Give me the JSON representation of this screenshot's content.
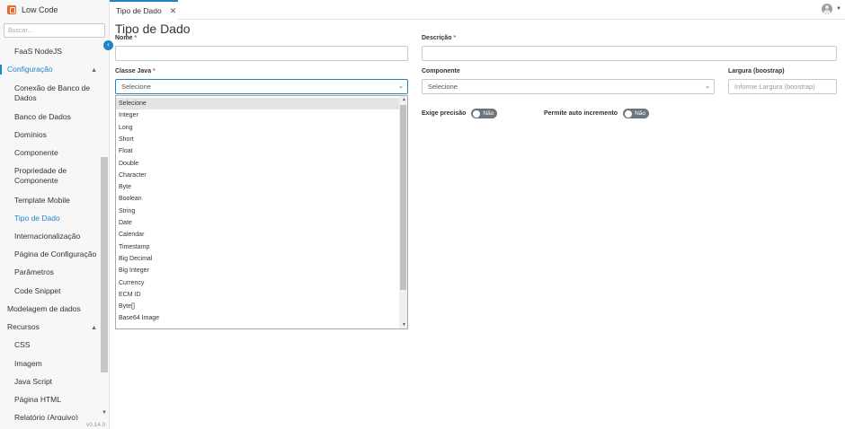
{
  "brand": {
    "title": "Low Code"
  },
  "search": {
    "placeholder": "Buscar..."
  },
  "sidebar": {
    "items": [
      {
        "label": "FaaS NodeJS"
      },
      {
        "label": "Configuração"
      },
      {
        "label": "Conexão de Banco de Dados"
      },
      {
        "label": "Banco de Dados"
      },
      {
        "label": "Domínios"
      },
      {
        "label": "Componente"
      },
      {
        "label": "Propriedade de Componente"
      },
      {
        "label": "Template Mobile"
      },
      {
        "label": "Tipo de Dado"
      },
      {
        "label": "Internacionalização"
      },
      {
        "label": "Página de Configuração"
      },
      {
        "label": "Parâmetros"
      },
      {
        "label": "Code Snippet"
      },
      {
        "label": "Modelagem de dados"
      },
      {
        "label": "Recursos"
      },
      {
        "label": "CSS"
      },
      {
        "label": "Imagem"
      },
      {
        "label": "Java Script"
      },
      {
        "label": "Página HTML"
      },
      {
        "label": "Relatório (Arquivo)"
      }
    ],
    "version": "v0.14.0"
  },
  "tabs": [
    {
      "label": "Tipo de Dado"
    }
  ],
  "page": {
    "title": "Tipo de Dado"
  },
  "form": {
    "nome_label": "Nome",
    "descricao_label": "Descrição",
    "required_mark": "*",
    "classe_label": "Classe Java",
    "classe_value": "Selecione",
    "componente_label": "Componente",
    "componente_value": "Selecione",
    "largura_label": "Largura (boostrap)",
    "largura_placeholder": "Informe Largura (boostrap)",
    "exige_label": "Exige precisão",
    "exige_value": "Não",
    "auto_label": "Permite auto incremento",
    "auto_value": "Não"
  },
  "dropdown": {
    "options": [
      "Selecione",
      "Integer",
      "Long",
      "Short",
      "Float",
      "Double",
      "Character",
      "Byte",
      "Boolean",
      "String",
      "Date",
      "Calendar",
      "Timestamp",
      "Big Decimal",
      "Big Integer",
      "Currency",
      "ECM ID",
      "Byte[]",
      "Base64 Image"
    ],
    "selected": "Selecione"
  },
  "icons": {
    "brand": "lowcode-logo-icon",
    "close": "close-icon",
    "avatar": "user-avatar-icon",
    "chevron": "chevron-down-icon",
    "collapse": "chevron-left-icon"
  },
  "colors": {
    "accent": "#1f84c6",
    "brand": "#e8692d",
    "required": "#d9534f",
    "toggle_off": "#6c757d"
  }
}
